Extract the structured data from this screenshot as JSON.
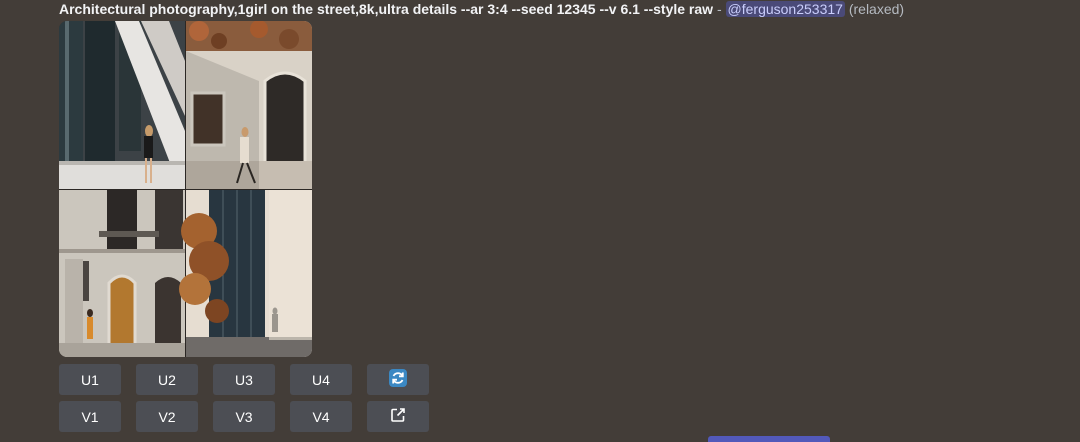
{
  "message": {
    "prompt": "Architectural photography,1girl on the street,8k,ultra details --ar 3:4 --seed 12345 --v 6.1 --style raw",
    "separator": " - ",
    "mention": "@ferguson253317",
    "status": "(relaxed)"
  },
  "buttons": {
    "upscale": [
      "U1",
      "U2",
      "U3",
      "U4"
    ],
    "variation": [
      "V1",
      "V2",
      "V3",
      "V4"
    ],
    "reroll_icon": "refresh-icon",
    "web_icon": "external-link-icon"
  },
  "colors": {
    "background": "#433d38",
    "button": "#4e5058",
    "accent": "#5865f2"
  }
}
